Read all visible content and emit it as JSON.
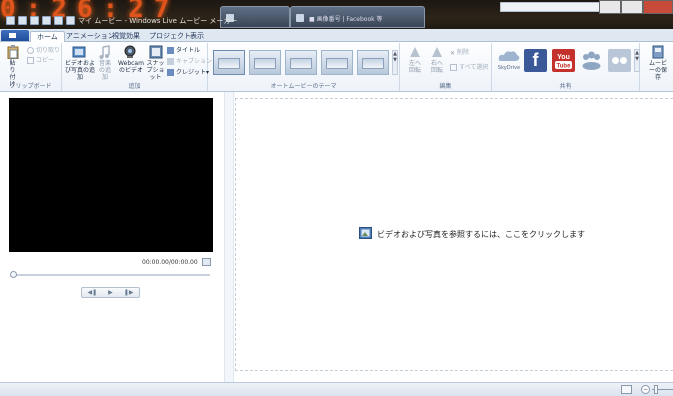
{
  "window": {
    "clock_digits": "0:26:27",
    "title": "マイ ムービー - Windows Live ムービー メーカー",
    "background_tab_label": "■ 画像番号 | Facebook 等"
  },
  "ribbon_tabs": [
    {
      "label": "ホーム",
      "active": true
    },
    {
      "label": "アニメーション",
      "active": false
    },
    {
      "label": "視覚効果",
      "active": false
    },
    {
      "label": "プロジェクト",
      "active": false
    },
    {
      "label": "表示",
      "active": false
    }
  ],
  "clipboard": {
    "paste_label": "貼り付け",
    "cut_label": "切り取り",
    "copy_label": "コピー",
    "group_label": "クリップボード"
  },
  "add": {
    "add_video_photo_label": "ビデオおよび写真の追加",
    "add_music_label": "音楽の追加",
    "webcam_label": "Webcam のビデオ",
    "snapshot_label": "スナップショット",
    "title_label": "タイトル",
    "caption_label": "キャプション",
    "credits_label": "クレジット",
    "group_label": "追加"
  },
  "automovie": {
    "group_label": "オートムービーのテーマ",
    "themes": 5
  },
  "edit": {
    "rotate_left_label": "左へ回転",
    "rotate_right_label": "右へ回転",
    "delete_label": "削除",
    "select_all_label": "すべて選択",
    "group_label": "編集"
  },
  "share": {
    "skydrive_label": "SkyDrive",
    "save_movie_label": "ムービーの保存",
    "group_label": "共有"
  },
  "preview": {
    "timecode": "00:00.00/00:00.00"
  },
  "storyboard": {
    "hint": "ビデオおよび写真を参照するには、ここをクリックします"
  },
  "colors": {
    "accent": "#1f4e9a",
    "clock": "#e0541c",
    "facebook": "#3b5998",
    "youtube": "#c4302b"
  }
}
